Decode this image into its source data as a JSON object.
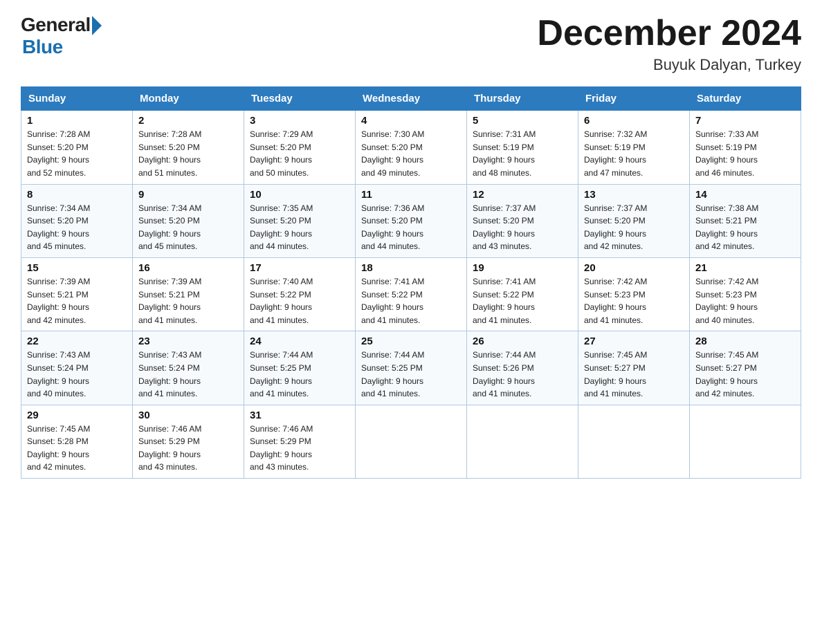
{
  "header": {
    "logo_general": "General",
    "logo_blue": "Blue",
    "title": "December 2024",
    "subtitle": "Buyuk Dalyan, Turkey"
  },
  "weekdays": [
    "Sunday",
    "Monday",
    "Tuesday",
    "Wednesday",
    "Thursday",
    "Friday",
    "Saturday"
  ],
  "weeks": [
    [
      {
        "day": "1",
        "sunrise": "7:28 AM",
        "sunset": "5:20 PM",
        "daylight": "9 hours and 52 minutes."
      },
      {
        "day": "2",
        "sunrise": "7:28 AM",
        "sunset": "5:20 PM",
        "daylight": "9 hours and 51 minutes."
      },
      {
        "day": "3",
        "sunrise": "7:29 AM",
        "sunset": "5:20 PM",
        "daylight": "9 hours and 50 minutes."
      },
      {
        "day": "4",
        "sunrise": "7:30 AM",
        "sunset": "5:20 PM",
        "daylight": "9 hours and 49 minutes."
      },
      {
        "day": "5",
        "sunrise": "7:31 AM",
        "sunset": "5:19 PM",
        "daylight": "9 hours and 48 minutes."
      },
      {
        "day": "6",
        "sunrise": "7:32 AM",
        "sunset": "5:19 PM",
        "daylight": "9 hours and 47 minutes."
      },
      {
        "day": "7",
        "sunrise": "7:33 AM",
        "sunset": "5:19 PM",
        "daylight": "9 hours and 46 minutes."
      }
    ],
    [
      {
        "day": "8",
        "sunrise": "7:34 AM",
        "sunset": "5:20 PM",
        "daylight": "9 hours and 45 minutes."
      },
      {
        "day": "9",
        "sunrise": "7:34 AM",
        "sunset": "5:20 PM",
        "daylight": "9 hours and 45 minutes."
      },
      {
        "day": "10",
        "sunrise": "7:35 AM",
        "sunset": "5:20 PM",
        "daylight": "9 hours and 44 minutes."
      },
      {
        "day": "11",
        "sunrise": "7:36 AM",
        "sunset": "5:20 PM",
        "daylight": "9 hours and 44 minutes."
      },
      {
        "day": "12",
        "sunrise": "7:37 AM",
        "sunset": "5:20 PM",
        "daylight": "9 hours and 43 minutes."
      },
      {
        "day": "13",
        "sunrise": "7:37 AM",
        "sunset": "5:20 PM",
        "daylight": "9 hours and 42 minutes."
      },
      {
        "day": "14",
        "sunrise": "7:38 AM",
        "sunset": "5:21 PM",
        "daylight": "9 hours and 42 minutes."
      }
    ],
    [
      {
        "day": "15",
        "sunrise": "7:39 AM",
        "sunset": "5:21 PM",
        "daylight": "9 hours and 42 minutes."
      },
      {
        "day": "16",
        "sunrise": "7:39 AM",
        "sunset": "5:21 PM",
        "daylight": "9 hours and 41 minutes."
      },
      {
        "day": "17",
        "sunrise": "7:40 AM",
        "sunset": "5:22 PM",
        "daylight": "9 hours and 41 minutes."
      },
      {
        "day": "18",
        "sunrise": "7:41 AM",
        "sunset": "5:22 PM",
        "daylight": "9 hours and 41 minutes."
      },
      {
        "day": "19",
        "sunrise": "7:41 AM",
        "sunset": "5:22 PM",
        "daylight": "9 hours and 41 minutes."
      },
      {
        "day": "20",
        "sunrise": "7:42 AM",
        "sunset": "5:23 PM",
        "daylight": "9 hours and 41 minutes."
      },
      {
        "day": "21",
        "sunrise": "7:42 AM",
        "sunset": "5:23 PM",
        "daylight": "9 hours and 40 minutes."
      }
    ],
    [
      {
        "day": "22",
        "sunrise": "7:43 AM",
        "sunset": "5:24 PM",
        "daylight": "9 hours and 40 minutes."
      },
      {
        "day": "23",
        "sunrise": "7:43 AM",
        "sunset": "5:24 PM",
        "daylight": "9 hours and 41 minutes."
      },
      {
        "day": "24",
        "sunrise": "7:44 AM",
        "sunset": "5:25 PM",
        "daylight": "9 hours and 41 minutes."
      },
      {
        "day": "25",
        "sunrise": "7:44 AM",
        "sunset": "5:25 PM",
        "daylight": "9 hours and 41 minutes."
      },
      {
        "day": "26",
        "sunrise": "7:44 AM",
        "sunset": "5:26 PM",
        "daylight": "9 hours and 41 minutes."
      },
      {
        "day": "27",
        "sunrise": "7:45 AM",
        "sunset": "5:27 PM",
        "daylight": "9 hours and 41 minutes."
      },
      {
        "day": "28",
        "sunrise": "7:45 AM",
        "sunset": "5:27 PM",
        "daylight": "9 hours and 42 minutes."
      }
    ],
    [
      {
        "day": "29",
        "sunrise": "7:45 AM",
        "sunset": "5:28 PM",
        "daylight": "9 hours and 42 minutes."
      },
      {
        "day": "30",
        "sunrise": "7:46 AM",
        "sunset": "5:29 PM",
        "daylight": "9 hours and 43 minutes."
      },
      {
        "day": "31",
        "sunrise": "7:46 AM",
        "sunset": "5:29 PM",
        "daylight": "9 hours and 43 minutes."
      },
      null,
      null,
      null,
      null
    ]
  ],
  "labels": {
    "sunrise_prefix": "Sunrise: ",
    "sunset_prefix": "Sunset: ",
    "daylight_prefix": "Daylight: "
  }
}
